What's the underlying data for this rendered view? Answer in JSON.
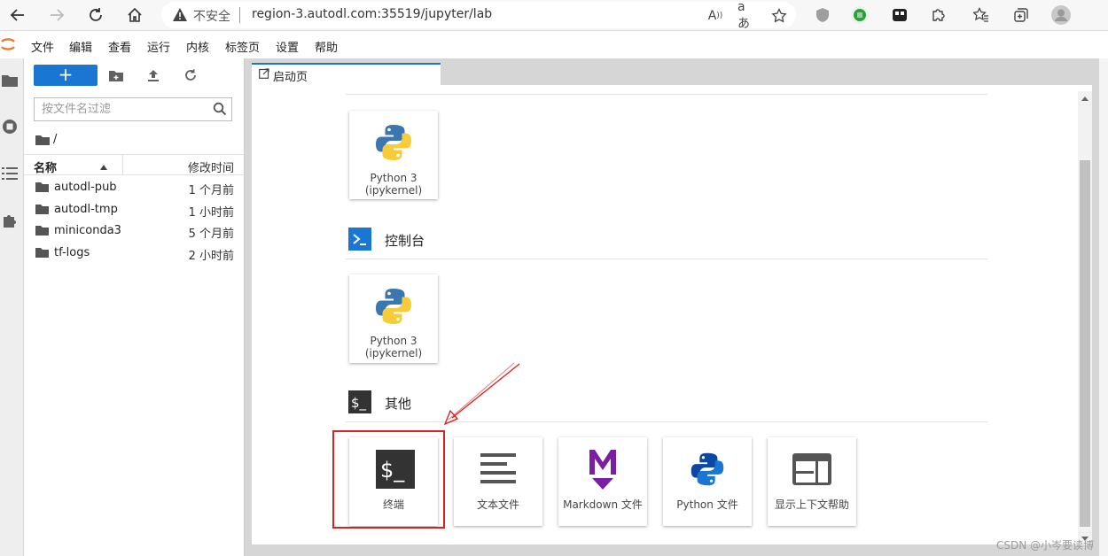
{
  "browser": {
    "security_label": "不安全",
    "url_host": "region-3.autodl.com",
    "url_rest": ":35519/jupyter/lab"
  },
  "menu": [
    "文件",
    "编辑",
    "查看",
    "运行",
    "内核",
    "标签页",
    "设置",
    "帮助"
  ],
  "filebrowser": {
    "new_label": "+",
    "filter_placeholder": "按文件名过滤",
    "path": "/",
    "col_name": "名称",
    "col_modified": "修改时间",
    "files": [
      {
        "name": "autodl-pub",
        "modified": "1 个月前"
      },
      {
        "name": "autodl-tmp",
        "modified": "1 小时前"
      },
      {
        "name": "miniconda3",
        "modified": "5 个月前"
      },
      {
        "name": "tf-logs",
        "modified": "2 小时前"
      }
    ]
  },
  "tab": {
    "label": "启动页"
  },
  "launcher": {
    "notebook_card": {
      "line1": "Python 3",
      "line2": "(ipykernel)"
    },
    "console_section": "控制台",
    "console_card": {
      "line1": "Python 3",
      "line2": "(ipykernel)"
    },
    "other_section": "其他",
    "other_cards": [
      "终端",
      "文本文件",
      "Markdown 文件",
      "Python 文件",
      "显示上下文帮助"
    ]
  },
  "watermark": "CSDN @小岑要读博",
  "colors": {
    "accent": "#1976d2",
    "highlight": "#e02020",
    "markdown": "#7b1fa2"
  }
}
